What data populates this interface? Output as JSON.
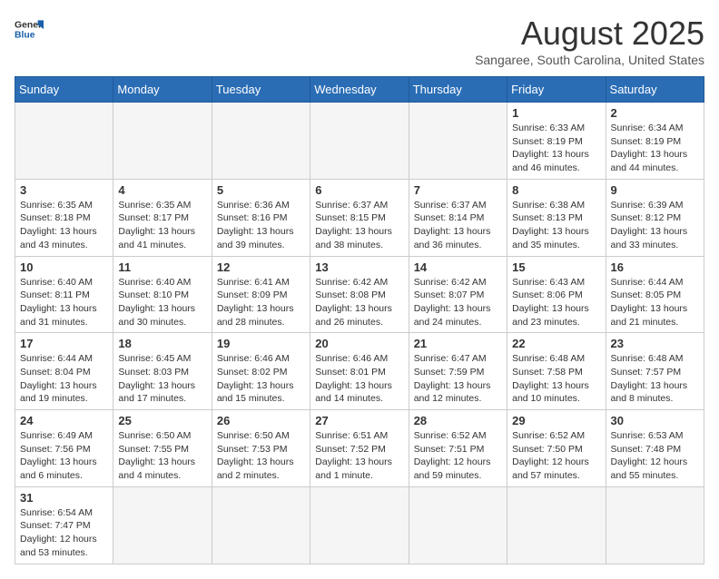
{
  "logo": {
    "text_general": "General",
    "text_blue": "Blue"
  },
  "header": {
    "month": "August 2025",
    "location": "Sangaree, South Carolina, United States"
  },
  "weekdays": [
    "Sunday",
    "Monday",
    "Tuesday",
    "Wednesday",
    "Thursday",
    "Friday",
    "Saturday"
  ],
  "weeks": [
    [
      {
        "day": "",
        "info": ""
      },
      {
        "day": "",
        "info": ""
      },
      {
        "day": "",
        "info": ""
      },
      {
        "day": "",
        "info": ""
      },
      {
        "day": "",
        "info": ""
      },
      {
        "day": "1",
        "info": "Sunrise: 6:33 AM\nSunset: 8:19 PM\nDaylight: 13 hours and 46 minutes."
      },
      {
        "day": "2",
        "info": "Sunrise: 6:34 AM\nSunset: 8:19 PM\nDaylight: 13 hours and 44 minutes."
      }
    ],
    [
      {
        "day": "3",
        "info": "Sunrise: 6:35 AM\nSunset: 8:18 PM\nDaylight: 13 hours and 43 minutes."
      },
      {
        "day": "4",
        "info": "Sunrise: 6:35 AM\nSunset: 8:17 PM\nDaylight: 13 hours and 41 minutes."
      },
      {
        "day": "5",
        "info": "Sunrise: 6:36 AM\nSunset: 8:16 PM\nDaylight: 13 hours and 39 minutes."
      },
      {
        "day": "6",
        "info": "Sunrise: 6:37 AM\nSunset: 8:15 PM\nDaylight: 13 hours and 38 minutes."
      },
      {
        "day": "7",
        "info": "Sunrise: 6:37 AM\nSunset: 8:14 PM\nDaylight: 13 hours and 36 minutes."
      },
      {
        "day": "8",
        "info": "Sunrise: 6:38 AM\nSunset: 8:13 PM\nDaylight: 13 hours and 35 minutes."
      },
      {
        "day": "9",
        "info": "Sunrise: 6:39 AM\nSunset: 8:12 PM\nDaylight: 13 hours and 33 minutes."
      }
    ],
    [
      {
        "day": "10",
        "info": "Sunrise: 6:40 AM\nSunset: 8:11 PM\nDaylight: 13 hours and 31 minutes."
      },
      {
        "day": "11",
        "info": "Sunrise: 6:40 AM\nSunset: 8:10 PM\nDaylight: 13 hours and 30 minutes."
      },
      {
        "day": "12",
        "info": "Sunrise: 6:41 AM\nSunset: 8:09 PM\nDaylight: 13 hours and 28 minutes."
      },
      {
        "day": "13",
        "info": "Sunrise: 6:42 AM\nSunset: 8:08 PM\nDaylight: 13 hours and 26 minutes."
      },
      {
        "day": "14",
        "info": "Sunrise: 6:42 AM\nSunset: 8:07 PM\nDaylight: 13 hours and 24 minutes."
      },
      {
        "day": "15",
        "info": "Sunrise: 6:43 AM\nSunset: 8:06 PM\nDaylight: 13 hours and 23 minutes."
      },
      {
        "day": "16",
        "info": "Sunrise: 6:44 AM\nSunset: 8:05 PM\nDaylight: 13 hours and 21 minutes."
      }
    ],
    [
      {
        "day": "17",
        "info": "Sunrise: 6:44 AM\nSunset: 8:04 PM\nDaylight: 13 hours and 19 minutes."
      },
      {
        "day": "18",
        "info": "Sunrise: 6:45 AM\nSunset: 8:03 PM\nDaylight: 13 hours and 17 minutes."
      },
      {
        "day": "19",
        "info": "Sunrise: 6:46 AM\nSunset: 8:02 PM\nDaylight: 13 hours and 15 minutes."
      },
      {
        "day": "20",
        "info": "Sunrise: 6:46 AM\nSunset: 8:01 PM\nDaylight: 13 hours and 14 minutes."
      },
      {
        "day": "21",
        "info": "Sunrise: 6:47 AM\nSunset: 7:59 PM\nDaylight: 13 hours and 12 minutes."
      },
      {
        "day": "22",
        "info": "Sunrise: 6:48 AM\nSunset: 7:58 PM\nDaylight: 13 hours and 10 minutes."
      },
      {
        "day": "23",
        "info": "Sunrise: 6:48 AM\nSunset: 7:57 PM\nDaylight: 13 hours and 8 minutes."
      }
    ],
    [
      {
        "day": "24",
        "info": "Sunrise: 6:49 AM\nSunset: 7:56 PM\nDaylight: 13 hours and 6 minutes."
      },
      {
        "day": "25",
        "info": "Sunrise: 6:50 AM\nSunset: 7:55 PM\nDaylight: 13 hours and 4 minutes."
      },
      {
        "day": "26",
        "info": "Sunrise: 6:50 AM\nSunset: 7:53 PM\nDaylight: 13 hours and 2 minutes."
      },
      {
        "day": "27",
        "info": "Sunrise: 6:51 AM\nSunset: 7:52 PM\nDaylight: 13 hours and 1 minute."
      },
      {
        "day": "28",
        "info": "Sunrise: 6:52 AM\nSunset: 7:51 PM\nDaylight: 12 hours and 59 minutes."
      },
      {
        "day": "29",
        "info": "Sunrise: 6:52 AM\nSunset: 7:50 PM\nDaylight: 12 hours and 57 minutes."
      },
      {
        "day": "30",
        "info": "Sunrise: 6:53 AM\nSunset: 7:48 PM\nDaylight: 12 hours and 55 minutes."
      }
    ],
    [
      {
        "day": "31",
        "info": "Sunrise: 6:54 AM\nSunset: 7:47 PM\nDaylight: 12 hours and 53 minutes."
      },
      {
        "day": "",
        "info": ""
      },
      {
        "day": "",
        "info": ""
      },
      {
        "day": "",
        "info": ""
      },
      {
        "day": "",
        "info": ""
      },
      {
        "day": "",
        "info": ""
      },
      {
        "day": "",
        "info": ""
      }
    ]
  ]
}
